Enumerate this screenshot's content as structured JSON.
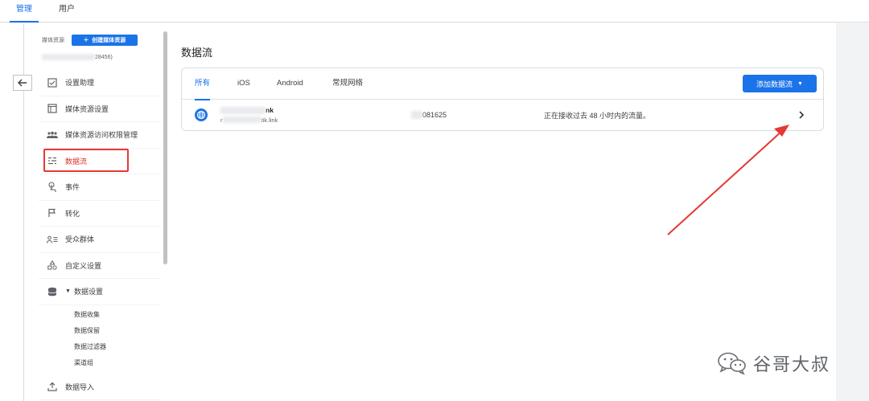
{
  "top_tabs": [
    {
      "label": "管理",
      "active": true
    },
    {
      "label": "用户",
      "active": false
    }
  ],
  "sidebar": {
    "property_label": "媒体资源",
    "create_button": "创建媒体资源",
    "property_id_suffix": "28456)",
    "items": [
      {
        "label": "设置助理",
        "icon": "checkbox-icon"
      },
      {
        "label": "媒体资源设置",
        "icon": "window-icon"
      },
      {
        "label": "媒体资源访问权限管理",
        "icon": "people-icon"
      },
      {
        "label": "数据流",
        "icon": "data-streams-icon",
        "active": true
      },
      {
        "label": "事件",
        "icon": "touch-icon"
      },
      {
        "label": "转化",
        "icon": "flag-icon"
      },
      {
        "label": "受众群体",
        "icon": "audience-icon"
      },
      {
        "label": "自定义设置",
        "icon": "shapes-icon"
      },
      {
        "label": "数据设置",
        "icon": "database-icon",
        "expanded": true
      }
    ],
    "sub_items": [
      "数据收集",
      "数据保留",
      "数据过滤器",
      "渠道组"
    ],
    "last_item": {
      "label": "数据导入",
      "icon": "upload-icon"
    }
  },
  "main": {
    "title": "数据流",
    "tabs": [
      {
        "label": "所有",
        "active": true
      },
      {
        "label": "iOS",
        "active": false
      },
      {
        "label": "Android",
        "active": false
      },
      {
        "label": "常规网络",
        "active": false
      }
    ],
    "add_button": "添加数据流",
    "stream": {
      "name_suffix": "nk",
      "url_prefix": "r",
      "url_suffix": "tik.link",
      "id_suffix": "081625",
      "status": "正在接收过去 48 小时内的流量。"
    }
  },
  "colors": {
    "accent": "#1a73e8",
    "highlight": "#e53935",
    "annotation_arrow": "#e53935"
  },
  "watermark": "谷哥大叔"
}
